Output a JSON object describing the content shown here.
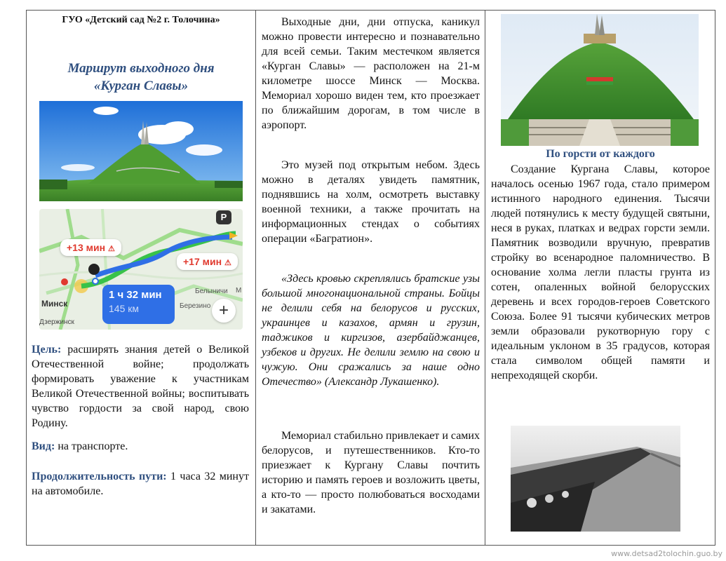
{
  "header": {
    "org": "ГУО «Детский сад №2 г.  Толочина»"
  },
  "title": {
    "line1": "Маршрут выходного дня",
    "line2": "«Курган Славы»"
  },
  "map": {
    "badge_left": "+13 мин",
    "badge_right": "+17 мин",
    "route_time": "1 ч 32 мин",
    "route_distance": "145 км",
    "city_minsk": "Минск",
    "city_dzerzhinsk": "Дзержинск",
    "town_1": "Белыничи",
    "town_2": "Березино",
    "parking": "P",
    "zoom_in": "+",
    "edge_letter": "М"
  },
  "goal": {
    "label": "Цель:",
    "text": " расширять знания детей о Великой Отечественной войне; продолжать формировать уважение к участникам Великой Отечественной войны; воспитывать чувство гордости за свой народ, свою Родину."
  },
  "kind": {
    "label": "Вид:",
    "text": " на транспорте."
  },
  "duration": {
    "label": "Продолжительность пути:",
    "text": " 1 часа 32 минут на автомобиле."
  },
  "column2": {
    "p1": "Выходные дни, дни отпуска, каникул можно провести интересно и познавательно для всей семьи. Таким местечком является «Курган Славы» — расположен на 21-м километре шоссе Минск — Москва. Мемориал хорошо виден тем, кто проезжает по ближайшим дорогам, в том числе в аэропорт.",
    "p2": "Это музей под открытым небом. Здесь можно в деталях увидеть памятник, поднявшись на холм, осмотреть выставку военной техники, а также прочитать на информационных стендах о событиях операции «Багратион».",
    "p3": "«Здесь кровью скреплялись братские узы большой многонациональной страны. Бойцы не делили себя на белорусов и русских, украинцев и казахов, армян и грузин, таджиков и киргизов, азербайджанцев, узбеков и других. Не делили землю на свою и чужую. Они сражались за наше одно Отечество» (Александр Лукашенко).",
    "p4": "Мемориал стабильно привлекает и самих белорусов, и путешественников. Кто-то приезжает к Кургану Славы почтить историю и память героев и возложить цветы, а кто-то — просто полюбоваться восходами и закатами."
  },
  "column3": {
    "subheading": "По горсти от каждого",
    "text": "Создание Кургана Славы, которое началось осенью 1967 года, стало примером истинного народного единения. Тысячи людей потянулись к месту будущей святыни, неся в руках, платках и ведрах горсти земли. Памятник возводили вручную, превратив стройку во всенародное паломничество. В основание холма легли пласты грунта из сотен, опаленных войной белорусских деревень и всех городов-героев Советского Союза. Более 91 тысячи кубических метров земли образовали рукотворную гору с идеальным уклоном в 35 градусов, которая стала символом общей памяти и непреходящей скорби."
  },
  "footer": {
    "url": "www.detsad2tolochin.guo.by"
  },
  "colors": {
    "accent": "#2f4f7f",
    "route_blue": "#2f6fe6",
    "route_green": "#39c24a",
    "delay_red": "#e03a2f",
    "grass": "#3f9a2e",
    "sky": "#2f7fe0"
  }
}
